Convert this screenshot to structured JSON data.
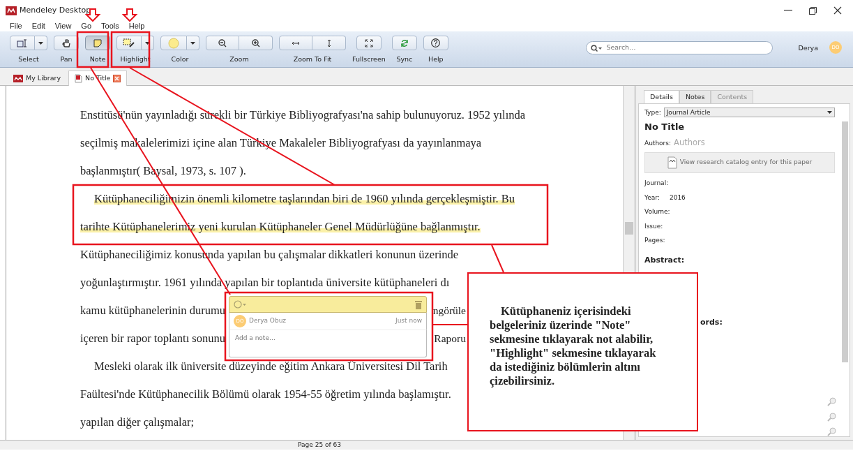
{
  "window": {
    "title": "Mendeley Desktop"
  },
  "menu": [
    "File",
    "Edit",
    "View",
    "Go",
    "Tools",
    "Help"
  ],
  "toolbar": [
    {
      "label": "Select",
      "kind": "split",
      "selected": false
    },
    {
      "label": "Pan",
      "kind": "single",
      "selected": false
    },
    {
      "label": "Note",
      "kind": "single",
      "selected": true
    },
    {
      "label": "Highlight",
      "kind": "split",
      "selected": false
    },
    {
      "label": "Color",
      "kind": "color",
      "selected": false
    },
    {
      "label": "Zoom",
      "kind": "pair",
      "selected": false
    },
    {
      "label": "Zoom To Fit",
      "kind": "pair",
      "selected": false
    },
    {
      "label": "Fullscreen",
      "kind": "single",
      "selected": false
    },
    {
      "label": "Sync",
      "kind": "single",
      "selected": false
    },
    {
      "label": "Help",
      "kind": "single",
      "selected": false
    }
  ],
  "search": {
    "placeholder": "Search…"
  },
  "user": {
    "name": "Derya",
    "initials": "DO"
  },
  "doc_tabs": [
    {
      "label": "My Library",
      "kind": "library",
      "selected": false,
      "closable": false
    },
    {
      "label": "No Title",
      "kind": "pdf",
      "selected": true,
      "closable": true
    }
  ],
  "document": {
    "lines": [
      {
        "text": "Enstitüsü'nün yayınladığı sürekli bir Türkiye Bibliyografyası'na sahip bulunuyoruz. 1952 yılında",
        "indent": false,
        "highlighted": false
      },
      {
        "text": "seçilmiş makalelerimizi içine alan Türkiye Makaleler Bibliyografyası da yayınlanmaya",
        "indent": false,
        "highlighted": false
      },
      {
        "text": "başlanmıştır( Baysal, 1973, s. 107 ).",
        "indent": false,
        "highlighted": false
      },
      {
        "text": "Kütüphaneciliğimizin önemli kilometre taşlarından biri de 1960 yılında gerçekleşmiştir. Bu",
        "indent": true,
        "highlighted": true
      },
      {
        "text": "tarihte Kütüphanelerimiz yeni kurulan Kütüphaneler Genel Müdürlüğüne bağlanmıştır.",
        "indent": false,
        "highlighted": true
      },
      {
        "text": "Kütüphaneciliğimiz konusunda yapılan bu çalışmalar dikkatleri konunun üzerinde",
        "indent": false,
        "highlighted": false
      },
      {
        "text": "yoğunlaştırmıştır. 1961 yılında yapılan bir toplantıda üniversite kütüphaneleri dı",
        "indent": false,
        "highlighted": false
      },
      {
        "text": "kamu kütüphanelerinin durumu",
        "tail": "ngörüle",
        "indent": false,
        "highlighted": false
      },
      {
        "text": "içeren bir rapor toplantı sonunu",
        "tail": "Raporu",
        "indent": false,
        "highlighted": false
      },
      {
        "text": "Mesleki olarak ilk üniversite düzeyinde eğitim Ankara Üniversitesi Dil Tarih",
        "indent": true,
        "highlighted": false
      },
      {
        "text": "Faültesi'nde Kütüphanecilik Bölümü olarak 1954-55 öğretim yılında başlamıştır.",
        "indent": false,
        "highlighted": false
      },
      {
        "text": "yapılan diğer çalışmalar;",
        "indent": false,
        "highlighted": false
      }
    ],
    "page_status": "Page 25 of 63"
  },
  "note": {
    "initials": "DO",
    "author": "Derya Obuz",
    "time": "Just now",
    "placeholder": "Add a note…"
  },
  "details": {
    "tabs": [
      {
        "label": "Details",
        "selected": true,
        "disabled": false
      },
      {
        "label": "Notes",
        "selected": false,
        "disabled": false
      },
      {
        "label": "Contents",
        "selected": false,
        "disabled": true
      }
    ],
    "type_label": "Type:",
    "type": "Journal Article",
    "title": "No Title",
    "authors_label": "Authors:",
    "authors_placeholder": "Authors",
    "catalog_button": "View research catalog entry for this paper",
    "fields": [
      {
        "label": "Journal:"
      },
      {
        "label": "Year:",
        "value": "2016"
      },
      {
        "label": "Volume:"
      },
      {
        "label": "Issue:"
      },
      {
        "label": "Pages:"
      }
    ],
    "abstract_label": "Abstract:",
    "keywords_fragment": "ords:"
  },
  "annotation": {
    "callout": "Kütüphaneniz içerisindeki belgeleriniz üzerinde \"Note\" sekmesine tıklayarak not alabilir, \"Highlight\" sekmesine tıklayarak da istediğiniz bölümlerin altını çizebilirsiniz."
  }
}
